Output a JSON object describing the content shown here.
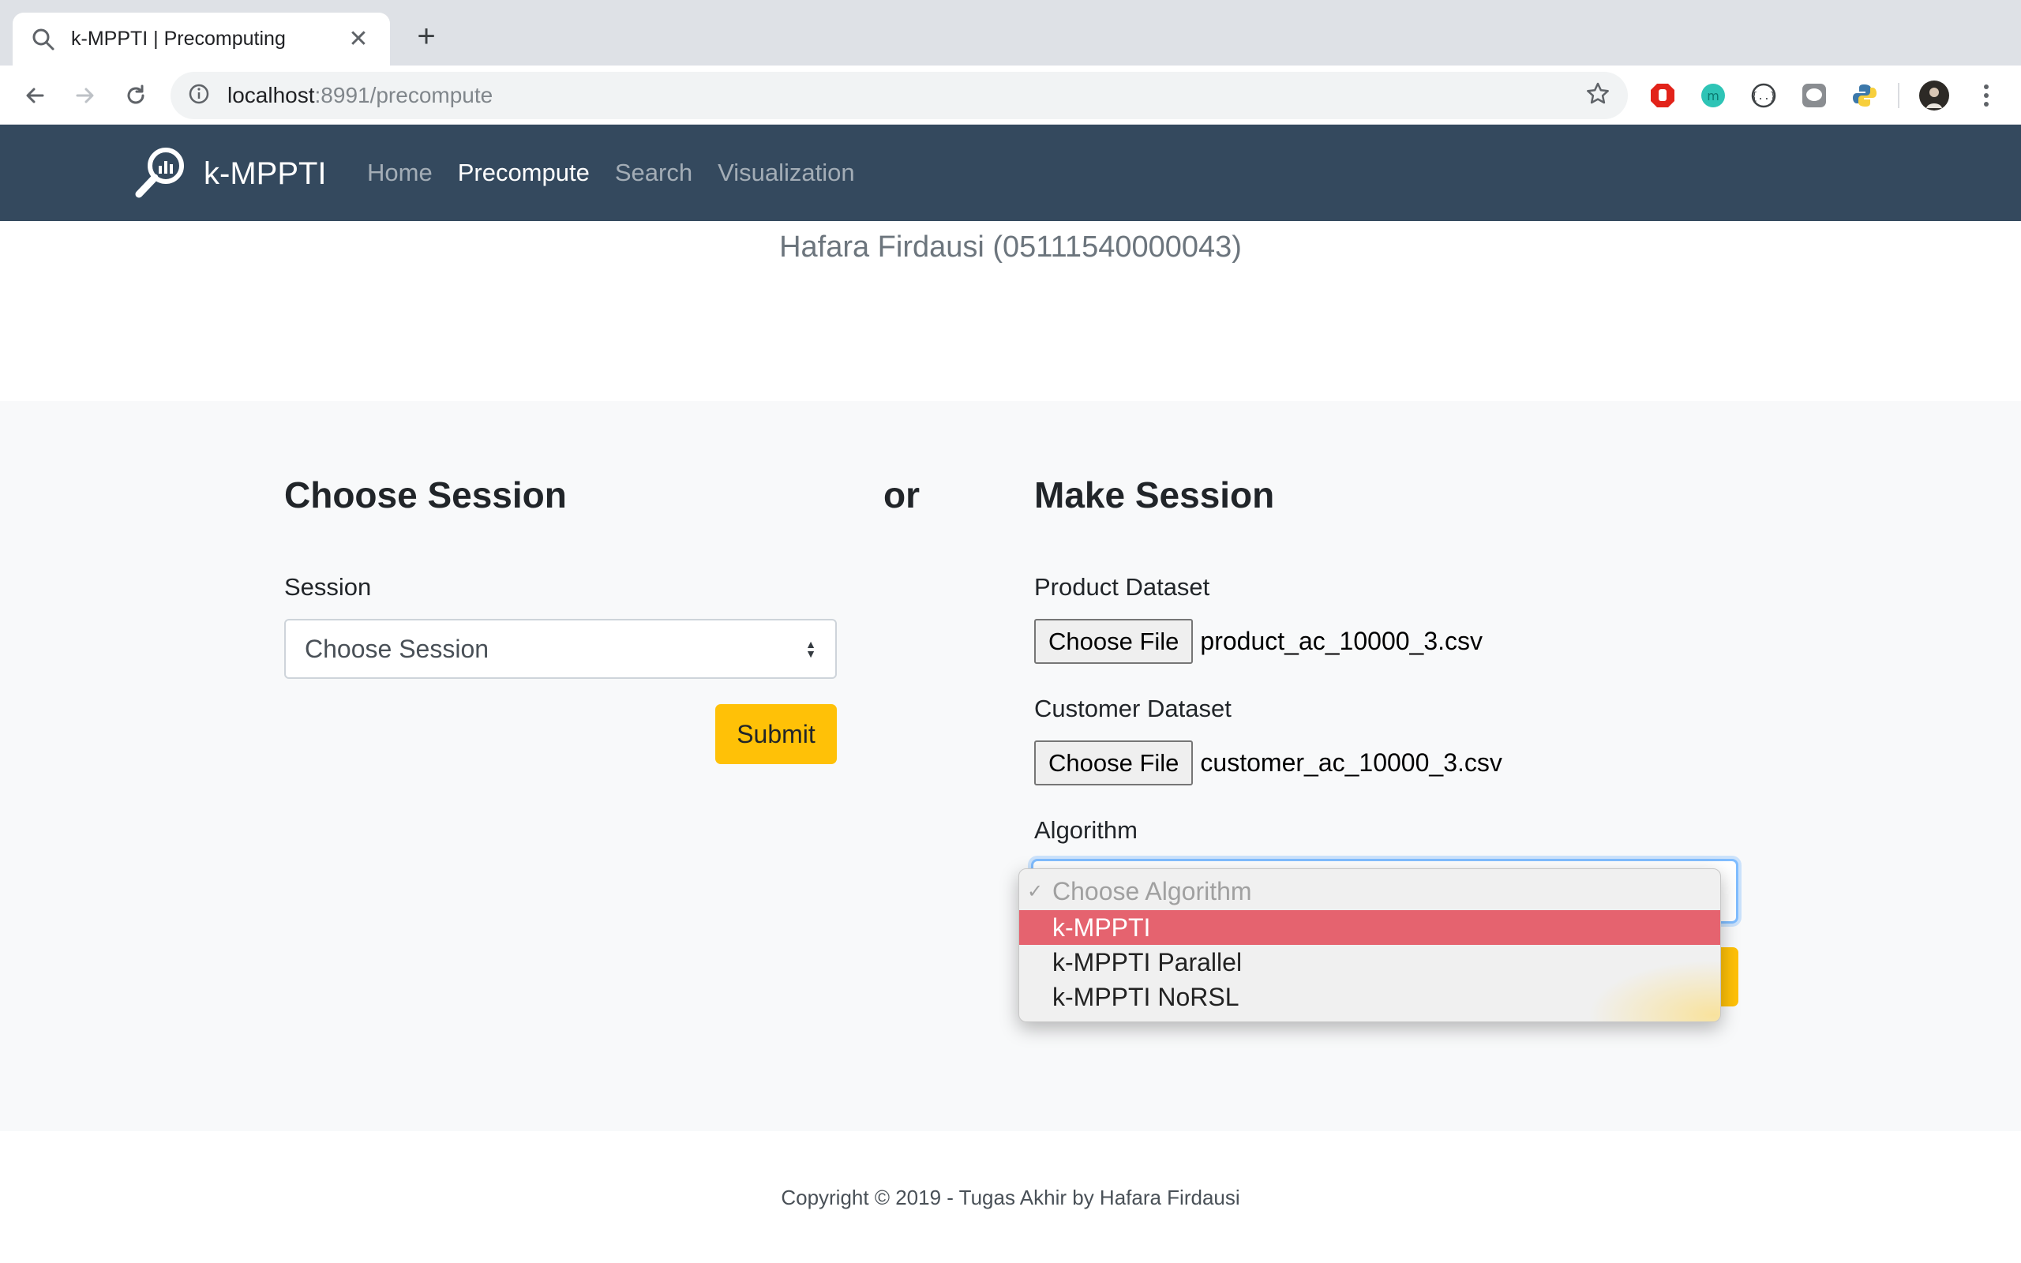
{
  "browser": {
    "tab_title": "k-MPPTI | Precomputing",
    "url_host": "localhost",
    "url_rest": ":8991/precompute"
  },
  "navbar": {
    "brand": "k-MPPTI",
    "links": [
      "Home",
      "Precompute",
      "Search",
      "Visualization"
    ],
    "active": "Precompute"
  },
  "author": "Hafara Firdausi (05111540000043)",
  "choose_session": {
    "heading": "Choose Session",
    "session_label": "Session",
    "session_value": "Choose Session",
    "submit_label": "Submit"
  },
  "separator": "or",
  "make_session": {
    "heading": "Make Session",
    "product_label": "Product Dataset",
    "product_button": "Choose File",
    "product_file": "product_ac_10000_3.csv",
    "customer_label": "Customer Dataset",
    "customer_button": "Choose File",
    "customer_file": "customer_ac_10000_3.csv",
    "algorithm_label": "Algorithm",
    "algorithm_options": [
      "Choose Algorithm",
      "k-MPPTI",
      "k-MPPTI Parallel",
      "k-MPPTI NoRSL"
    ],
    "algorithm_highlighted": "k-MPPTI"
  },
  "footer": "Copyright © 2019 - Tugas Akhir by Hafara Firdausi",
  "colors": {
    "navbar": "#34495e",
    "accent_button": "#ffc107",
    "highlight": "#e5636f"
  }
}
